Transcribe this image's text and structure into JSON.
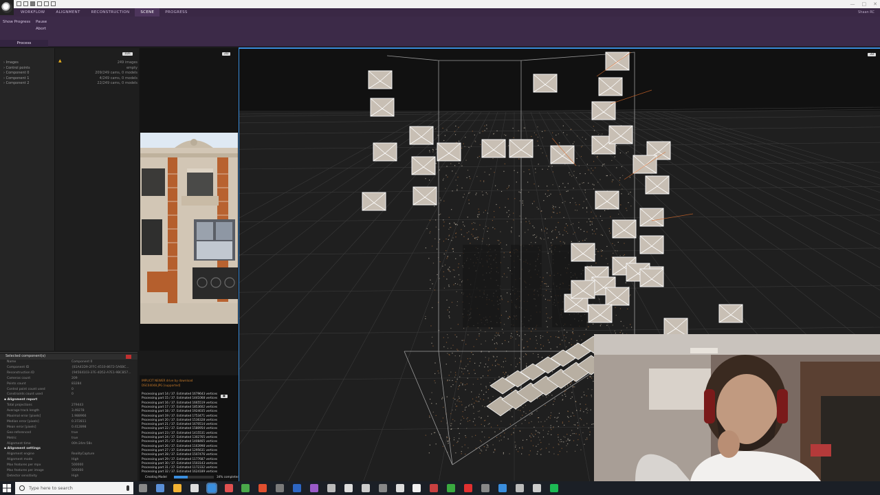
{
  "app": {
    "menu_tabs": [
      "WORKFLOW",
      "ALIGNMENT",
      "RECONSTRUCTION",
      "SCENE",
      "PROGRESS"
    ],
    "active_tab": "SCENE",
    "user": "Shaan RC"
  },
  "ribbon": {
    "show_progress": "Show Progress",
    "pause": "Pause",
    "abort": "Abort",
    "group_label": "Process"
  },
  "panels": {
    "onedee_badge": "1Ds",
    "twod_badge": "2D",
    "threed_badge": "3D"
  },
  "tree": [
    {
      "label": "Images",
      "value": "249 images"
    },
    {
      "label": "Control points",
      "value": "empty"
    },
    {
      "label": "Component 0",
      "value": "209/249 cams, 0 models"
    },
    {
      "label": "Component 1",
      "value": "4/249 cams, 0 models"
    },
    {
      "label": "Component 2",
      "value": "22/249 cams, 0 models"
    }
  ],
  "properties": {
    "header": "Selected component(s)",
    "rows": [
      {
        "k": "Name",
        "v": "Component 0"
      },
      {
        "k": "Component ID",
        "v": "{81A41D9-2FFC-4510-8672-5A6BC..."
      },
      {
        "k": "Reconstruction ID",
        "v": "{94564103-37E-4D52-A7E1-9BCB57..."
      },
      {
        "k": "Cameras count",
        "v": "209"
      },
      {
        "k": "Points count",
        "v": "83284"
      },
      {
        "k": "Control point count used",
        "v": "0"
      },
      {
        "k": "Constraints count used",
        "v": "0"
      }
    ],
    "section1": "Alignment report",
    "rows2": [
      {
        "k": "Total projections",
        "v": "279443"
      },
      {
        "k": "Average track length",
        "v": "3.49278"
      },
      {
        "k": "Maximal error [pixels]",
        "v": "1.988966"
      },
      {
        "k": "Median error [pixels]",
        "v": "0.372811"
      },
      {
        "k": "Mean error [pixels]",
        "v": "0.412898"
      },
      {
        "k": "Geo-referenced",
        "v": "true"
      },
      {
        "k": "Metric",
        "v": "true"
      },
      {
        "k": "Alignment time",
        "v": "00h:24m:58s"
      }
    ],
    "section2": "Alignment settings",
    "rows3": [
      {
        "k": "Alignment engine",
        "v": "RealityCapture"
      },
      {
        "k": "Alignment mode",
        "v": "High"
      },
      {
        "k": "Max features per mpx",
        "v": "500000"
      },
      {
        "k": "Max features per image",
        "v": "500000"
      },
      {
        "k": "Detector sensitivity",
        "v": "High"
      }
    ]
  },
  "console": {
    "warn1": "IMPLICIT NEWER drive by download",
    "warn2": "DSC04048.JPG [supported]",
    "lines": [
      "Processing part 14 / 37. Estimated 1679643 vertices",
      "Processing part 15 / 37. Estimated 1441068 vertices",
      "Processing part 16 / 37. Estimated 1665519 vertices",
      "Processing part 17 / 37. Estimated 1853602 vertices",
      "Processing part 18 / 37. Estimated 1924035 vertices",
      "Processing part 19 / 37. Estimated 1753471 vertices",
      "Processing part 20 / 37. Estimated 1536328 vertices",
      "Processing part 21 / 37. Estimated 1670514 vertices",
      "Processing part 22 / 37. Estimated 1580954 vertices",
      "Processing part 23 / 37. Estimated 1415531 vertices",
      "Processing part 24 / 37. Estimated 1302765 vertices",
      "Processing part 25 / 37. Estimated 1408465 vertices",
      "Processing part 26 / 37. Estimated 1163998 vertices",
      "Processing part 27 / 37. Estimated 1295631 vertices",
      "Processing part 28 / 37. Estimated 1507476 vertices",
      "Processing part 29 / 37. Estimated 1177687 vertices",
      "Processing part 30 / 37. Estimated 1503143 vertices",
      "Processing part 31 / 37. Estimated 1172332 vertices",
      "Processing part 32 / 37. Estimated 1624189 vertices"
    ],
    "progress_label": "Creating Model",
    "progress_pct": "34% completed",
    "progress_value": 0.34
  },
  "taskbar": {
    "search_placeholder": "Type here to search"
  },
  "colors": {
    "accent": "#3a8ede",
    "ribbon": "#3c2a48",
    "warning": "#c77a2a"
  }
}
